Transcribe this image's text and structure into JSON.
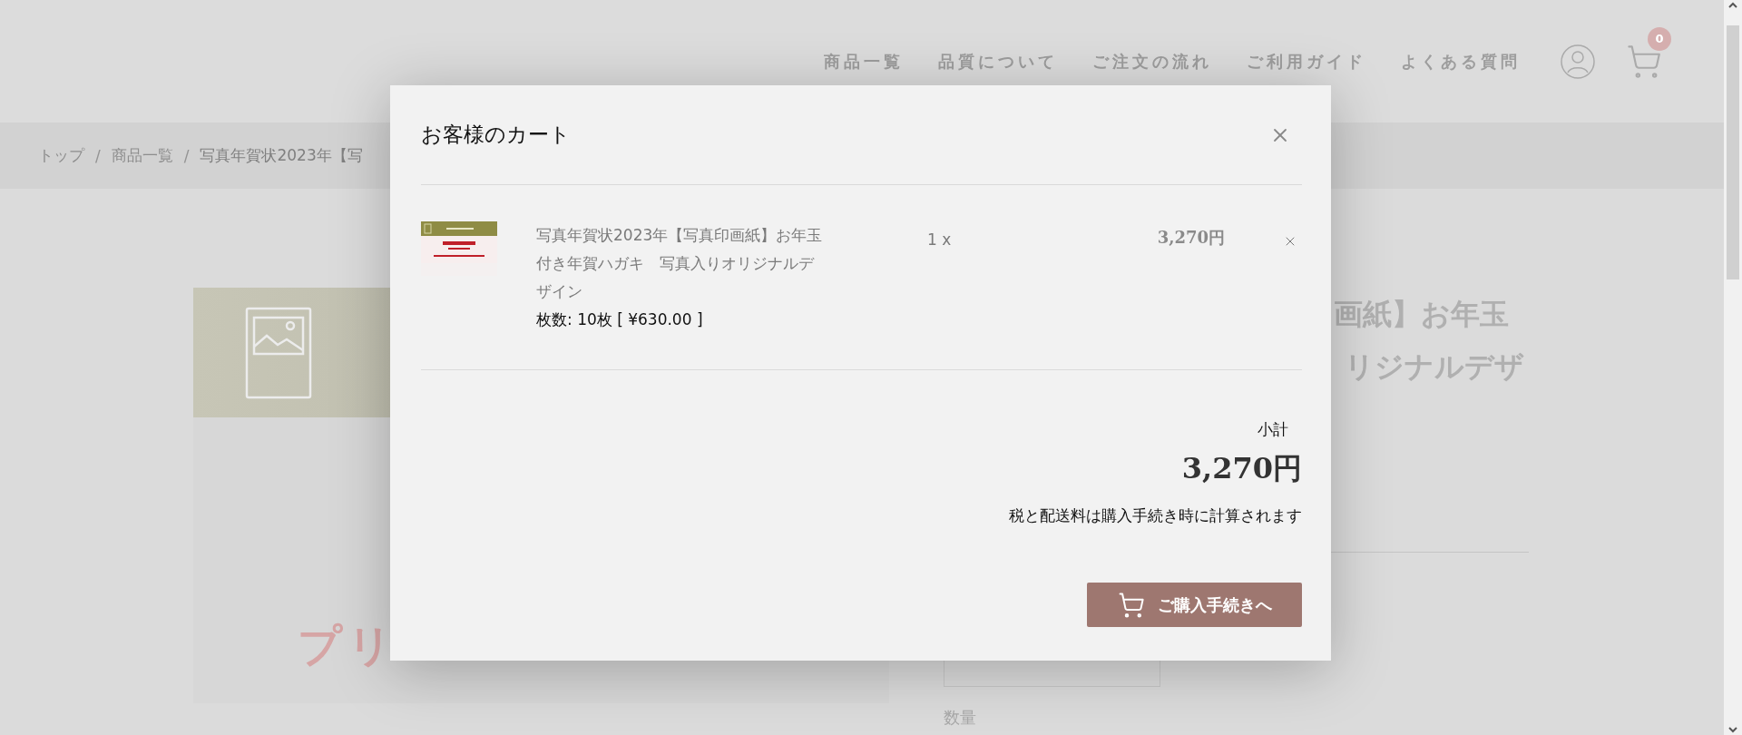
{
  "header": {
    "nav": [
      "商品一覧",
      "品質について",
      "ご注文の流れ",
      "ご利用ガイド",
      "よくある質問"
    ],
    "cart_count": "0"
  },
  "breadcrumb": {
    "separator": "/",
    "items": [
      "トップ",
      "商品一覧",
      "写真年賀状2023年【写"
    ]
  },
  "product": {
    "image_text": "プリ",
    "title_lines": [
      "画紙】お年玉",
      "リジナルデザ"
    ],
    "quantity_label": "数量"
  },
  "cart": {
    "title": "お客様のカート",
    "items": [
      {
        "name": "写真年賀状2023年【写真印画紙】お年玉付き年賀ハガキ　写真入りオリジナルデザイン",
        "variant": "枚数: 10枚 [ ¥630.00 ]",
        "quantity": "1 x",
        "price": "3,270円"
      }
    ],
    "subtotal_label": "小計",
    "subtotal": "3,270円",
    "note": "税と配送料は購入手続き時に計算されます",
    "checkout_button": "ご購入手続きへ"
  }
}
